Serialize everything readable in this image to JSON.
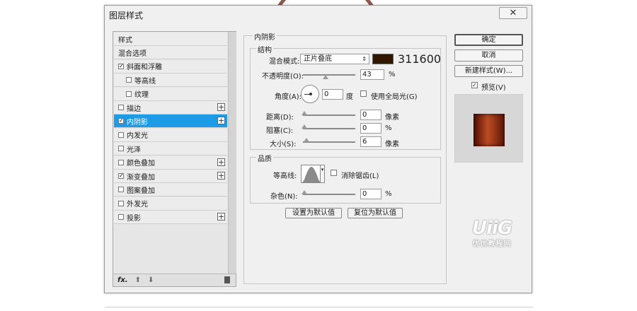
{
  "dialog": {
    "title": "图层样式",
    "close_label": "✕"
  },
  "styles_panel": {
    "items": [
      {
        "label": "样式",
        "checkbox": false,
        "checked": false,
        "indent": 0,
        "plus": false,
        "selected": false
      },
      {
        "label": "混合选项",
        "checkbox": false,
        "checked": false,
        "indent": 0,
        "plus": false,
        "selected": false
      },
      {
        "label": "斜面和浮雕",
        "checkbox": true,
        "checked": true,
        "indent": 0,
        "plus": false,
        "selected": false
      },
      {
        "label": "等高线",
        "checkbox": true,
        "checked": false,
        "indent": 1,
        "plus": false,
        "selected": false
      },
      {
        "label": "纹理",
        "checkbox": true,
        "checked": false,
        "indent": 1,
        "plus": false,
        "selected": false
      },
      {
        "label": "描边",
        "checkbox": true,
        "checked": false,
        "indent": 0,
        "plus": true,
        "selected": false
      },
      {
        "label": "内阴影",
        "checkbox": true,
        "checked": true,
        "indent": 0,
        "plus": true,
        "selected": true
      },
      {
        "label": "内发光",
        "checkbox": true,
        "checked": false,
        "indent": 0,
        "plus": false,
        "selected": false
      },
      {
        "label": "光泽",
        "checkbox": true,
        "checked": false,
        "indent": 0,
        "plus": false,
        "selected": false
      },
      {
        "label": "颜色叠加",
        "checkbox": true,
        "checked": false,
        "indent": 0,
        "plus": true,
        "selected": false
      },
      {
        "label": "渐变叠加",
        "checkbox": true,
        "checked": true,
        "indent": 0,
        "plus": true,
        "selected": false
      },
      {
        "label": "图案叠加",
        "checkbox": true,
        "checked": false,
        "indent": 0,
        "plus": false,
        "selected": false
      },
      {
        "label": "外发光",
        "checkbox": true,
        "checked": false,
        "indent": 0,
        "plus": false,
        "selected": false
      },
      {
        "label": "投影",
        "checkbox": true,
        "checked": false,
        "indent": 0,
        "plus": true,
        "selected": false
      }
    ],
    "footer": {
      "fx_label": "fx."
    }
  },
  "inner_shadow": {
    "section_title": "内阴影",
    "structure": {
      "legend": "结构",
      "blend_mode_label": "混合模式:",
      "blend_mode_value": "正片叠底",
      "color_hex": "311600",
      "color_swatch": "#311600",
      "opacity_label": "不透明度(O):",
      "opacity_value": "43",
      "opacity_unit": "%",
      "opacity_level": 0.43,
      "angle_label": "角度(A):",
      "angle_value": "0",
      "angle_unit": "度",
      "global_light_label": "使用全局光(G)",
      "global_light_checked": false,
      "distance_label": "距离(D):",
      "distance_value": "0",
      "distance_unit": "像素",
      "choke_label": "阻塞(C):",
      "choke_value": "0",
      "choke_unit": "%",
      "size_label": "大小(S):",
      "size_value": "6",
      "size_unit": "像素"
    },
    "quality": {
      "legend": "品质",
      "contour_label": "等高线:",
      "anti_alias_label": "消除锯齿(L)",
      "anti_alias_checked": false,
      "noise_label": "杂色(N):",
      "noise_value": "0",
      "noise_unit": "%"
    },
    "set_default_label": "设置为默认值",
    "reset_default_label": "复位为默认值"
  },
  "actions": {
    "ok_label": "确定",
    "cancel_label": "取消",
    "new_style_label": "新建样式(W)...",
    "preview_label": "预览(V)",
    "preview_checked": true
  },
  "watermark": {
    "big": "UiiG",
    "small": "优优教程网"
  }
}
